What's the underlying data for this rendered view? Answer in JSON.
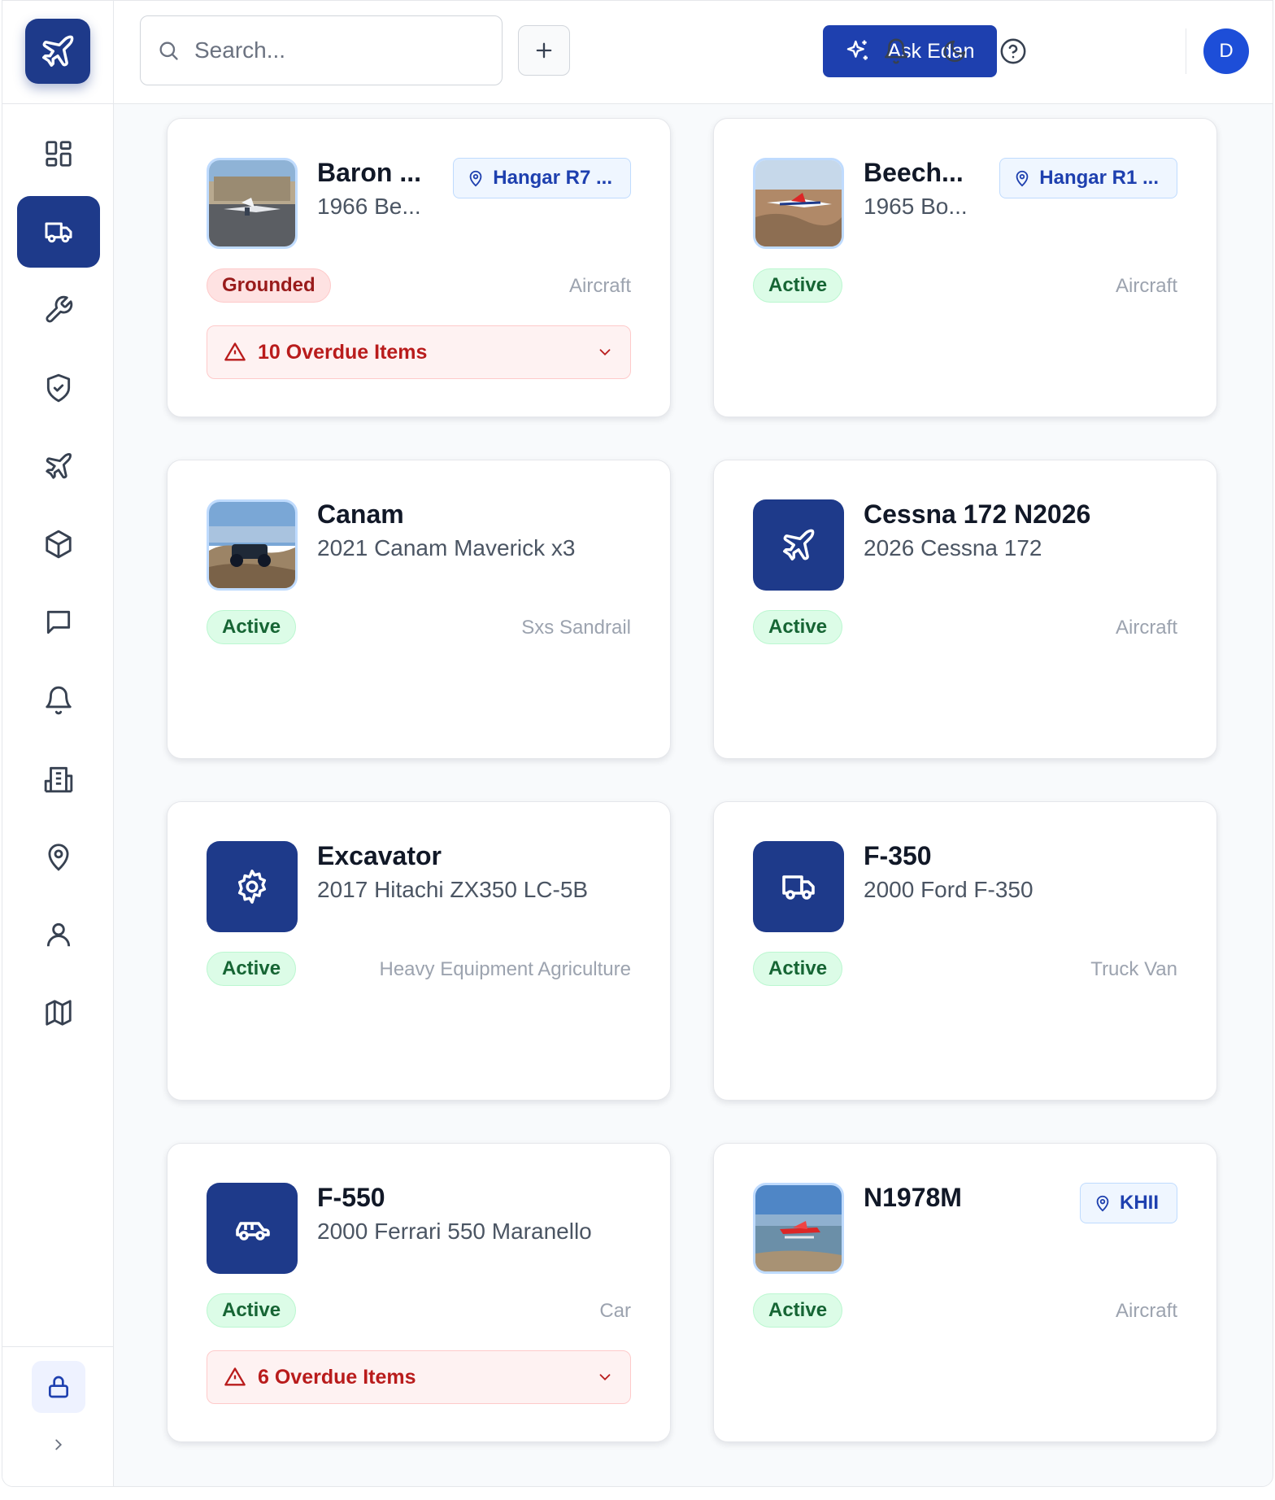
{
  "search": {
    "placeholder": "Search..."
  },
  "header": {
    "ask_label": "Ask Edan",
    "avatar_initial": "D"
  },
  "sidebar": {
    "items": [
      {
        "icon": "dashboard-icon",
        "active": false
      },
      {
        "icon": "truck-icon",
        "active": true
      },
      {
        "icon": "wrench-icon",
        "active": false
      },
      {
        "icon": "shield-check-icon",
        "active": false
      },
      {
        "icon": "plane-icon",
        "active": false
      },
      {
        "icon": "package-icon",
        "active": false
      },
      {
        "icon": "chat-icon",
        "active": false
      },
      {
        "icon": "bell-icon",
        "active": false
      },
      {
        "icon": "building-icon",
        "active": false
      },
      {
        "icon": "map-pin-icon",
        "active": false
      },
      {
        "icon": "user-icon",
        "active": false
      },
      {
        "icon": "map-icon",
        "active": false
      }
    ]
  },
  "colors": {
    "brand": "#1e3a8a",
    "accent": "#1e40af",
    "active_status": "#166534",
    "grounded_status": "#991b1b"
  },
  "assets": [
    {
      "name": "Baron ...",
      "model": "1966 Be...",
      "location": "Hangar R7 ...",
      "status": "Grounded",
      "category": "Aircraft",
      "overdue": "10 Overdue Items",
      "thumb": "photo-plane-hangar"
    },
    {
      "name": "Beech...",
      "model": "1965 Bo...",
      "location": "Hangar R1 ...",
      "status": "Active",
      "category": "Aircraft",
      "overdue": "",
      "thumb": "photo-plane-flight"
    },
    {
      "name": "Canam",
      "model": "2021 Canam Maverick x3",
      "location": "",
      "status": "Active",
      "category": "Sxs Sandrail",
      "overdue": "",
      "thumb": "photo-offroad"
    },
    {
      "name": "Cessna 172 N2026",
      "model": "2026 Cessna 172",
      "location": "",
      "status": "Active",
      "category": "Aircraft",
      "overdue": "",
      "thumb": "plane-icon"
    },
    {
      "name": "Excavator",
      "model": "2017 Hitachi ZX350 LC-5B",
      "location": "",
      "status": "Active",
      "category": "Heavy Equipment Agriculture",
      "overdue": "",
      "thumb": "gear-icon"
    },
    {
      "name": "F-350",
      "model": "2000 Ford F-350",
      "location": "",
      "status": "Active",
      "category": "Truck Van",
      "overdue": "",
      "thumb": "truck-icon"
    },
    {
      "name": "F-550",
      "model": "2000 Ferrari 550 Maranello",
      "location": "",
      "status": "Active",
      "category": "Car",
      "overdue": "6 Overdue Items",
      "thumb": "car-icon"
    },
    {
      "name": "N1978M",
      "model": "",
      "location": "KHII",
      "status": "Active",
      "category": "Aircraft",
      "overdue": "",
      "thumb": "photo-seaplane"
    }
  ]
}
